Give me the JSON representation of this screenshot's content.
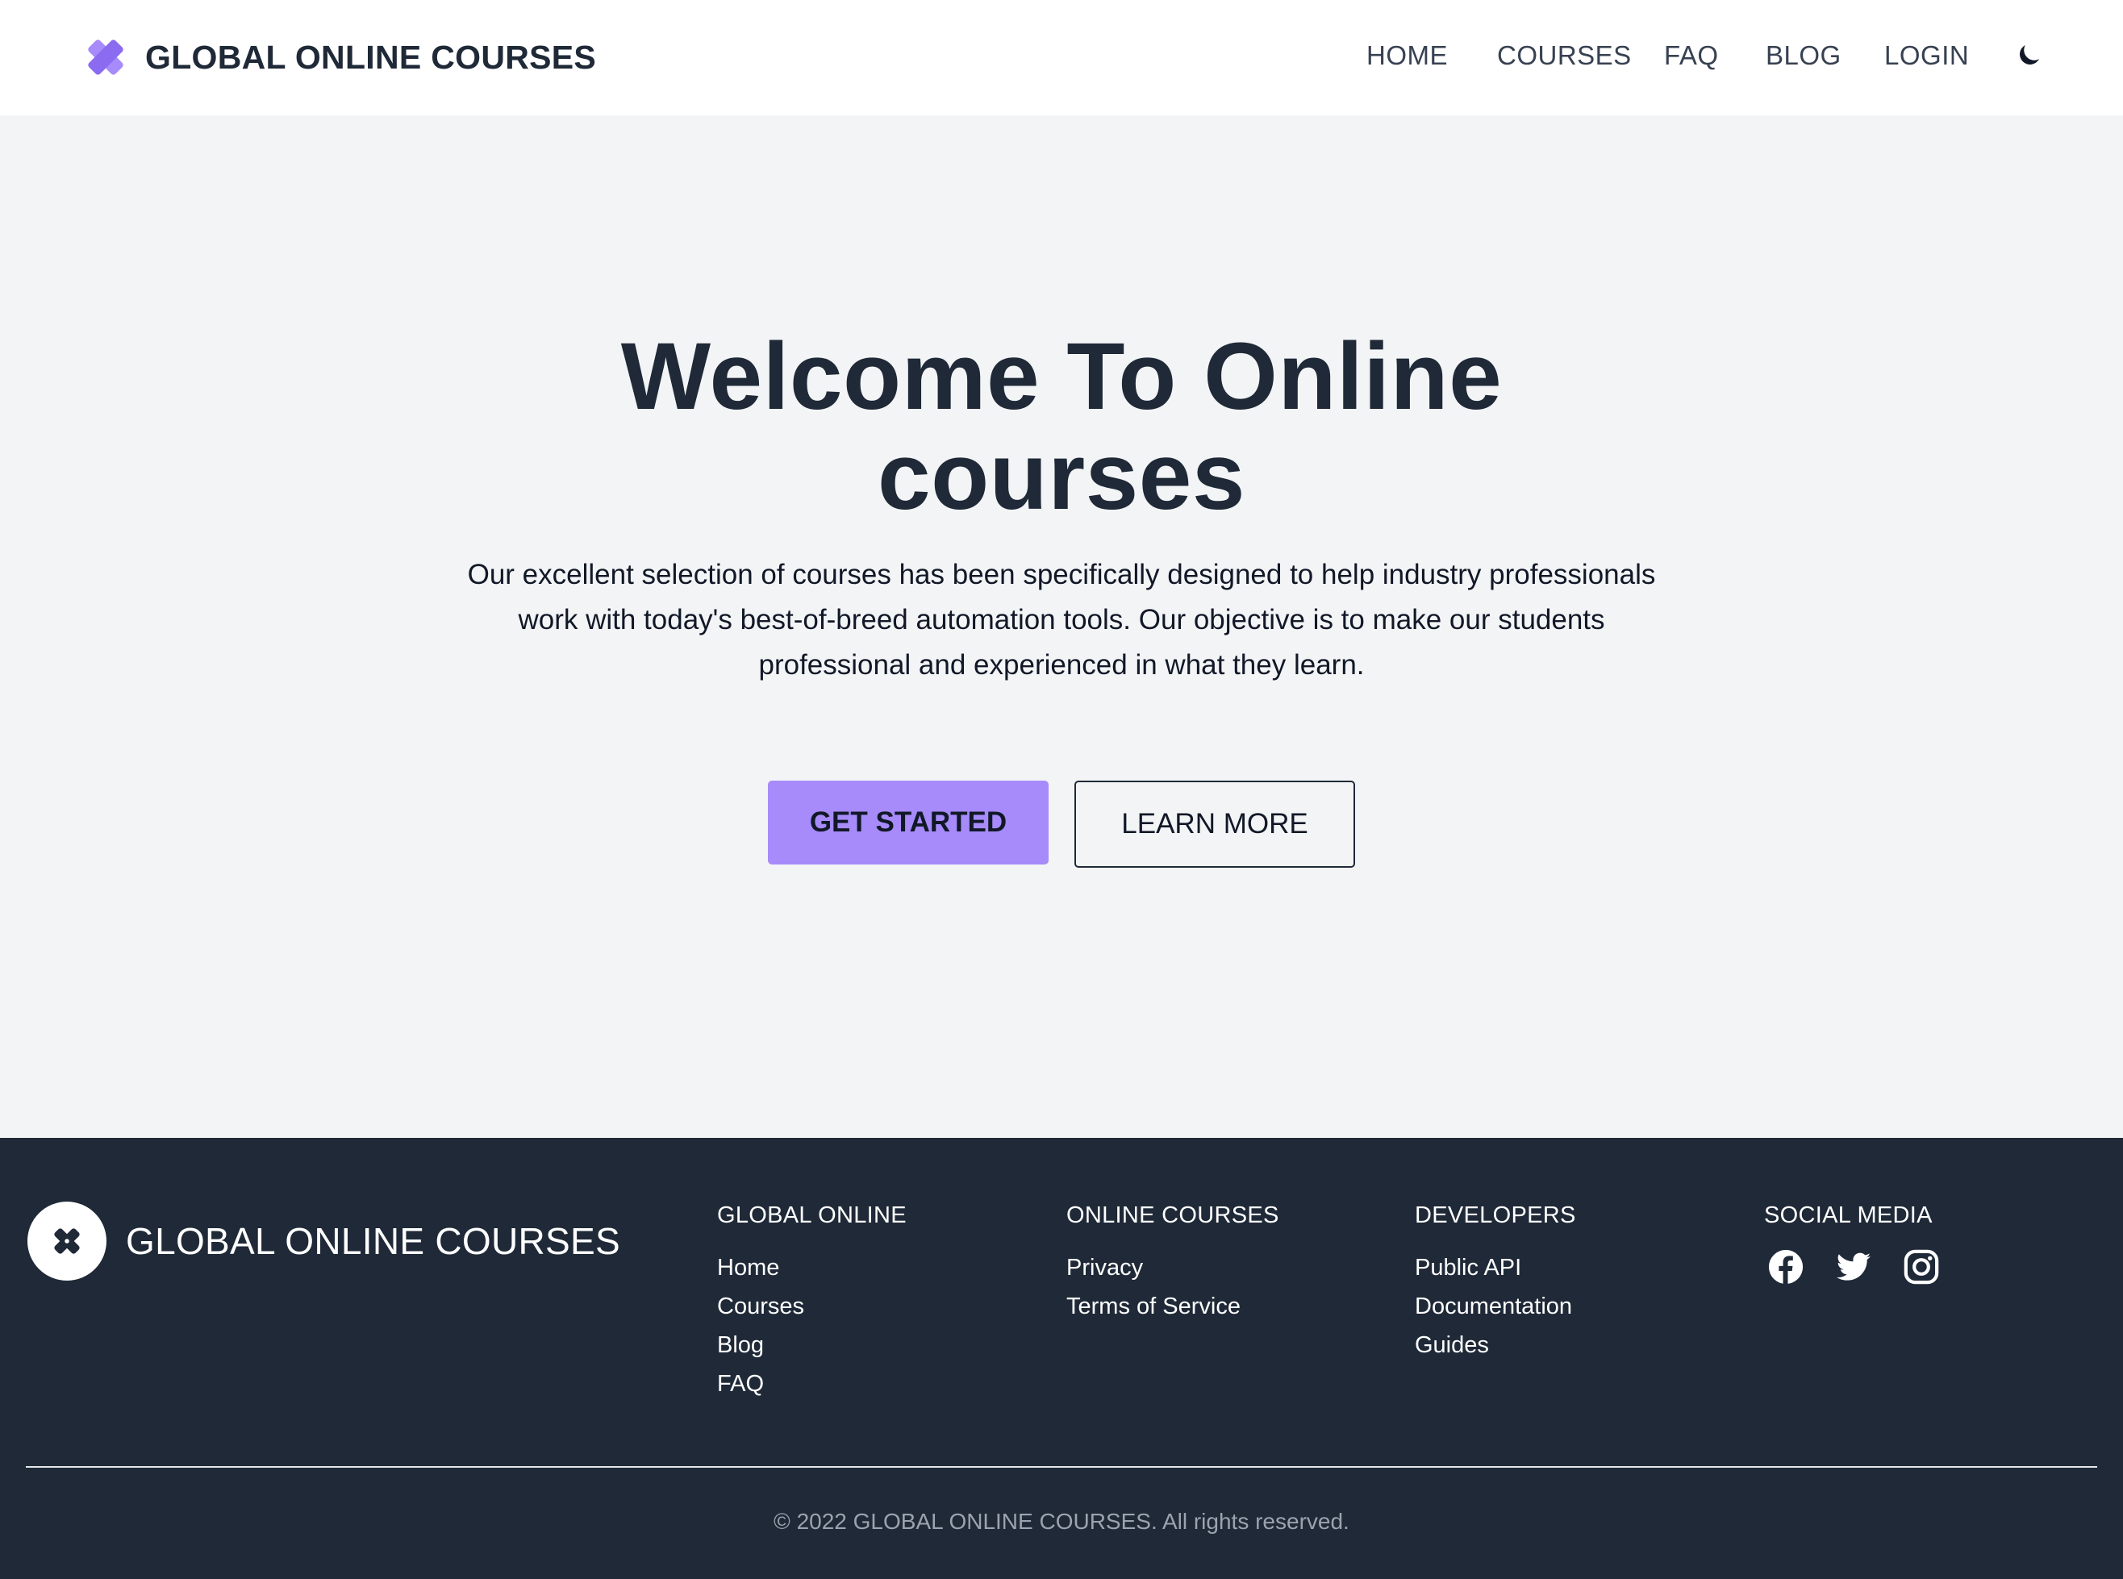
{
  "header": {
    "brand": "GLOBAL ONLINE COURSES",
    "nav": [
      {
        "label": "HOME"
      },
      {
        "label": "COURSES"
      },
      {
        "label": "FAQ"
      },
      {
        "label": "BLOG"
      },
      {
        "label": "LOGIN"
      }
    ],
    "theme_toggle_icon": "moon-icon"
  },
  "hero": {
    "title_line1": "Welcome To Online",
    "title_line2": "courses",
    "description": "Our excellent selection of courses has been specifically designed to help industry professionals work with today's best-of-breed automation tools. Our objective is to make our students professional and experienced in what they learn.",
    "primary_button": "GET STARTED",
    "secondary_button": "LEARN MORE"
  },
  "footer": {
    "brand": "GLOBAL ONLINE COURSES",
    "columns": [
      {
        "title": "GLOBAL ONLINE",
        "links": [
          "Home",
          "Courses",
          "Blog",
          "FAQ"
        ]
      },
      {
        "title": "ONLINE COURSES",
        "links": [
          "Privacy",
          "Terms of Service"
        ]
      },
      {
        "title": "DEVELOPERS",
        "links": [
          "Public API",
          "Documentation",
          "Guides"
        ]
      }
    ],
    "social": {
      "title": "SOCIAL MEDIA",
      "icons": [
        "facebook-icon",
        "twitter-icon",
        "instagram-icon"
      ]
    },
    "copyright": "© 2022 GLOBAL ONLINE COURSES. All rights reserved."
  },
  "colors": {
    "accent": "#a78bfa",
    "header_bg": "#ffffff",
    "hero_bg": "#f3f4f6",
    "footer_bg": "#1f2937",
    "text_dark": "#1f2937"
  }
}
